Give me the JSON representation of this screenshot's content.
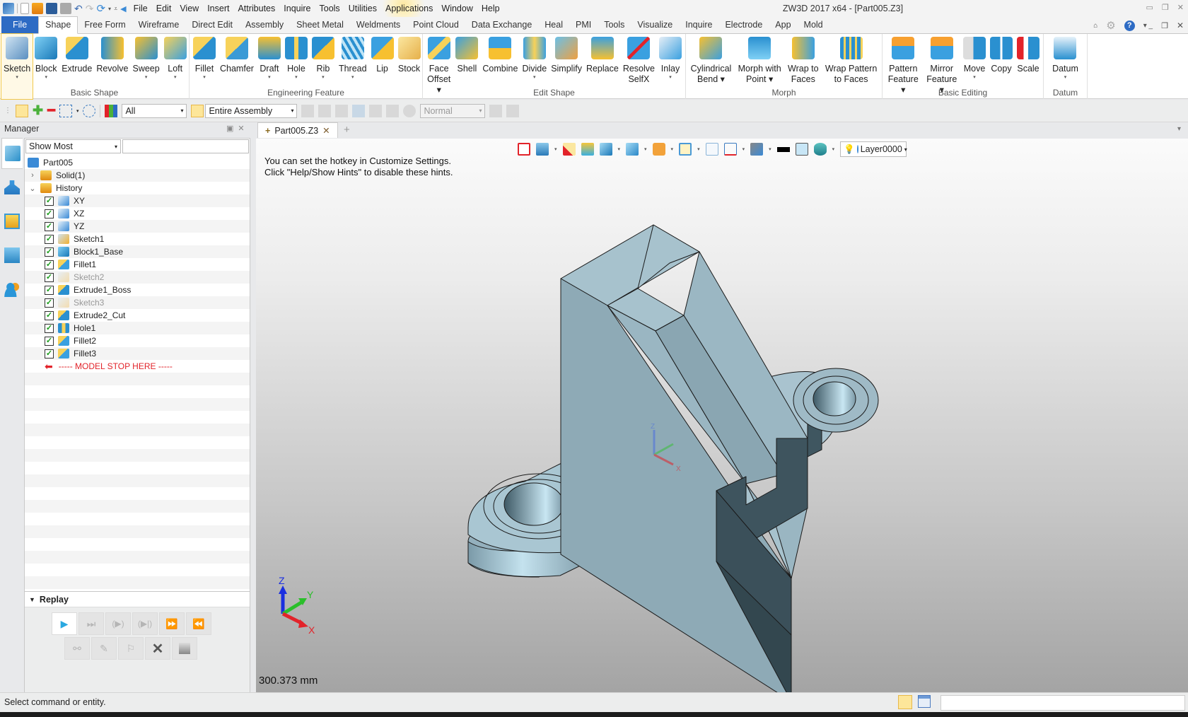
{
  "app": {
    "title": "ZW3D 2017  x64 - [Part005.Z3]",
    "menu": [
      "File",
      "Edit",
      "View",
      "Insert",
      "Attributes",
      "Inquire",
      "Tools",
      "Utilities",
      "Applications",
      "Window",
      "Help"
    ]
  },
  "ribbon": {
    "file_label": "File",
    "tabs": [
      "Shape",
      "Free Form",
      "Wireframe",
      "Direct Edit",
      "Assembly",
      "Sheet Metal",
      "Weldments",
      "Point Cloud",
      "Data Exchange",
      "Heal",
      "PMI",
      "Tools",
      "Visualize",
      "Inquire",
      "Electrode",
      "App",
      "Mold"
    ],
    "active_tab": "Shape",
    "groups": [
      {
        "label": "Basic Shape",
        "buttons": [
          {
            "l1": "Sketch",
            "l2": "▾",
            "icon": "sketch-icon"
          },
          {
            "l1": "Block",
            "l2": "▾",
            "icon": "block-icon"
          },
          {
            "l1": "Extrude",
            "l2": "",
            "icon": "extrude-icon"
          },
          {
            "l1": "Revolve",
            "l2": "",
            "icon": "revolve-icon"
          },
          {
            "l1": "Sweep",
            "l2": "▾",
            "icon": "sweep-icon"
          },
          {
            "l1": "Loft",
            "l2": "▾",
            "icon": "loft-icon"
          }
        ]
      },
      {
        "label": "Engineering Feature",
        "buttons": [
          {
            "l1": "Fillet",
            "l2": "▾",
            "icon": "fillet-icon"
          },
          {
            "l1": "Chamfer",
            "l2": "",
            "icon": "chamfer-icon"
          },
          {
            "l1": "Draft",
            "l2": "▾",
            "icon": "draft-icon"
          },
          {
            "l1": "Hole",
            "l2": "▾",
            "icon": "hole-icon"
          },
          {
            "l1": "Rib",
            "l2": "▾",
            "icon": "rib-icon"
          },
          {
            "l1": "Thread",
            "l2": "▾",
            "icon": "thread-icon"
          },
          {
            "l1": "Lip",
            "l2": "",
            "icon": "lip-icon"
          },
          {
            "l1": "Stock",
            "l2": "",
            "icon": "stock-icon"
          }
        ]
      },
      {
        "label": "Edit Shape",
        "buttons": [
          {
            "l1": "Face",
            "l2": "Offset ▾",
            "icon": "face-offset-icon"
          },
          {
            "l1": "Shell",
            "l2": "",
            "icon": "shell-icon"
          },
          {
            "l1": "Combine",
            "l2": "",
            "icon": "combine-icon"
          },
          {
            "l1": "Divide",
            "l2": "▾",
            "icon": "divide-icon"
          },
          {
            "l1": "Simplify",
            "l2": "",
            "icon": "simplify-icon"
          },
          {
            "l1": "Replace",
            "l2": "",
            "icon": "replace-icon"
          },
          {
            "l1": "Resolve",
            "l2": "SelfX",
            "icon": "resolve-selfx-icon"
          },
          {
            "l1": "Inlay",
            "l2": "▾",
            "icon": "inlay-icon"
          }
        ]
      },
      {
        "label": "Morph",
        "buttons": [
          {
            "l1": "Cylindrical",
            "l2": "Bend  ▾",
            "icon": "cylindrical-bend-icon"
          },
          {
            "l1": "Morph with",
            "l2": "Point  ▾",
            "icon": "morph-point-icon"
          },
          {
            "l1": "Wrap to",
            "l2": "Faces",
            "icon": "wrap-faces-icon"
          },
          {
            "l1": "Wrap Pattern",
            "l2": "to Faces",
            "icon": "wrap-pattern-icon"
          }
        ]
      },
      {
        "label": "Basic Editing",
        "buttons": [
          {
            "l1": "Pattern",
            "l2": "Feature ▾",
            "icon": "pattern-feature-icon"
          },
          {
            "l1": "Mirror",
            "l2": "Feature ▾",
            "icon": "mirror-feature-icon"
          },
          {
            "l1": "Move",
            "l2": "▾",
            "icon": "move-icon"
          },
          {
            "l1": "Copy",
            "l2": "",
            "icon": "copy-icon"
          },
          {
            "l1": "Scale",
            "l2": "",
            "icon": "scale-icon"
          }
        ]
      },
      {
        "label": "Datum",
        "buttons": [
          {
            "l1": "Datum",
            "l2": "▾",
            "icon": "datum-icon"
          }
        ]
      }
    ]
  },
  "toolbar": {
    "filter_value": "All",
    "scope_value": "Entire Assembly",
    "mode_value": "Normal"
  },
  "manager": {
    "title": "Manager",
    "show_filter": "Show Most",
    "filter_text": "",
    "tree": [
      {
        "label": "Part005",
        "level": 0,
        "icon": "part-icon",
        "type": "root"
      },
      {
        "label": "Solid(1)",
        "level": 1,
        "icon": "folder-icon",
        "type": "folder",
        "expand": "›"
      },
      {
        "label": "History",
        "level": 1,
        "icon": "folder-open-icon",
        "type": "folder",
        "expand": "⌄"
      },
      {
        "label": "XY",
        "level": 2,
        "icon": "datum-plane-icon",
        "checked": true
      },
      {
        "label": "XZ",
        "level": 2,
        "icon": "datum-plane-icon",
        "checked": true
      },
      {
        "label": "YZ",
        "level": 2,
        "icon": "datum-plane-icon",
        "checked": true
      },
      {
        "label": "Sketch1",
        "level": 2,
        "icon": "sketch-icon",
        "checked": true
      },
      {
        "label": "Block1_Base",
        "level": 2,
        "icon": "block-icon",
        "checked": true
      },
      {
        "label": "Fillet1",
        "level": 2,
        "icon": "fillet-icon",
        "checked": true
      },
      {
        "label": "Sketch2",
        "level": 2,
        "icon": "sketch-icon",
        "checked": true,
        "dim": true
      },
      {
        "label": "Extrude1_Boss",
        "level": 2,
        "icon": "extrude-icon",
        "checked": true
      },
      {
        "label": "Sketch3",
        "level": 2,
        "icon": "sketch-icon",
        "checked": true,
        "dim": true
      },
      {
        "label": "Extrude2_Cut",
        "level": 2,
        "icon": "extrude-icon",
        "checked": true
      },
      {
        "label": "Hole1",
        "level": 2,
        "icon": "hole-icon",
        "checked": true
      },
      {
        "label": "Fillet2",
        "level": 2,
        "icon": "fillet-icon",
        "checked": true
      },
      {
        "label": "Fillet3",
        "level": 2,
        "icon": "fillet-icon",
        "checked": true
      },
      {
        "label": "----- MODEL STOP HERE -----",
        "level": 2,
        "icon": "arrow-left-icon",
        "type": "stop"
      }
    ],
    "replay_label": "Replay"
  },
  "document": {
    "tab_label": "Part005.Z3",
    "hint_line1": "You can set the hotkey in Customize Settings.",
    "hint_line2": "Click \"Help/Show Hints\" to disable these hints.",
    "layer": "Layer0000",
    "scale_readout": "300.373 mm",
    "axis_labels": {
      "x": "X",
      "y": "Y",
      "z": "Z"
    }
  },
  "status": {
    "message": "Select command or entity.",
    "input_value": ""
  }
}
